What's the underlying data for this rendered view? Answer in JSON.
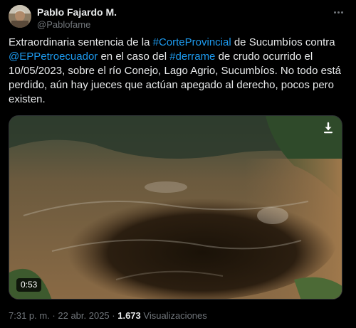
{
  "author": {
    "display_name": "Pablo Fajardo M.",
    "handle": "@Pablofame"
  },
  "tweet": {
    "segments": [
      {
        "text": "Extraordinaria sentencia de la ",
        "link": false
      },
      {
        "text": "#CorteProvincial",
        "link": true
      },
      {
        "text": " de Sucumbíos contra ",
        "link": false
      },
      {
        "text": "@EPPetroecuador",
        "link": true
      },
      {
        "text": "  en el caso del ",
        "link": false
      },
      {
        "text": "#derrame",
        "link": true
      },
      {
        "text": " de crudo ocurrido el 10/05/2023, sobre el río Conejo, Lago Agrio, Sucumbíos. No todo está perdido, aún hay jueces que actúan apegado al derecho, pocos pero existen.",
        "link": false
      }
    ]
  },
  "media": {
    "duration": "0:53",
    "download_icon": "download-arrow-icon"
  },
  "meta": {
    "time": "7:31 p. m.",
    "separator1": " · ",
    "date": "22 abr. 2025",
    "separator2": " · ",
    "views_count": "1.673",
    "views_label": " Visualizaciones"
  },
  "colors": {
    "background": "#000000",
    "text": "#e7e9ea",
    "muted": "#71767b",
    "link": "#1d9bf0"
  }
}
